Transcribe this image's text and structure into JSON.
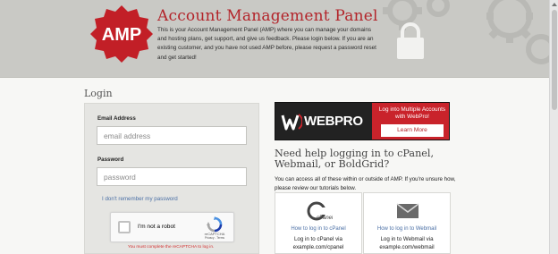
{
  "header": {
    "logo_text": "AMP",
    "title": "Account Management Panel",
    "intro": "This is your Account Management Panel (AMP) where you can manage your domains and hosting plans, get support, and give us feedback. Please login below. If you are an existing customer, and you have not used AMP before, please request a password reset and get started!"
  },
  "login": {
    "heading": "Login",
    "email_label": "Email Address",
    "email_placeholder": "email address",
    "email_value": "",
    "password_label": "Password",
    "password_placeholder": "password",
    "password_value": "",
    "forgot_link": "I don't remember my password",
    "captcha": {
      "label": "I'm not a robot",
      "brand": "reCAPTCHA",
      "terms": "Privacy - Terms",
      "error": "You must complete the reCAPTCHA to log in."
    }
  },
  "webpro": {
    "wordmark": "WEBPRO",
    "promo": "Log into Multiple Accounts with WebPro!",
    "button": "Learn More",
    "colors": {
      "dark": "#222222",
      "red": "#c9232b"
    }
  },
  "help": {
    "heading": "Need help logging in to cPanel, Webmail, or BoldGrid?",
    "text": "You can access all of these within or outside of AMP. If you're unsure how, please review our tutorials below.",
    "tutorials": [
      {
        "icon": "cpanel-icon",
        "link": "How to log in to cPanel",
        "desc_line1": "Log in to cPanel via",
        "desc_line2": "example.com/cpanel"
      },
      {
        "icon": "envelope-icon",
        "link": "How to log in to Webmail",
        "desc_line1": "Log in to Webmail via",
        "desc_line2": "example.com/webmail"
      }
    ]
  },
  "colors": {
    "brand_red": "#b3242a",
    "link_blue": "#4a6fa5",
    "error_red": "#d32f2f",
    "header_bg": "#c9c9c5"
  }
}
